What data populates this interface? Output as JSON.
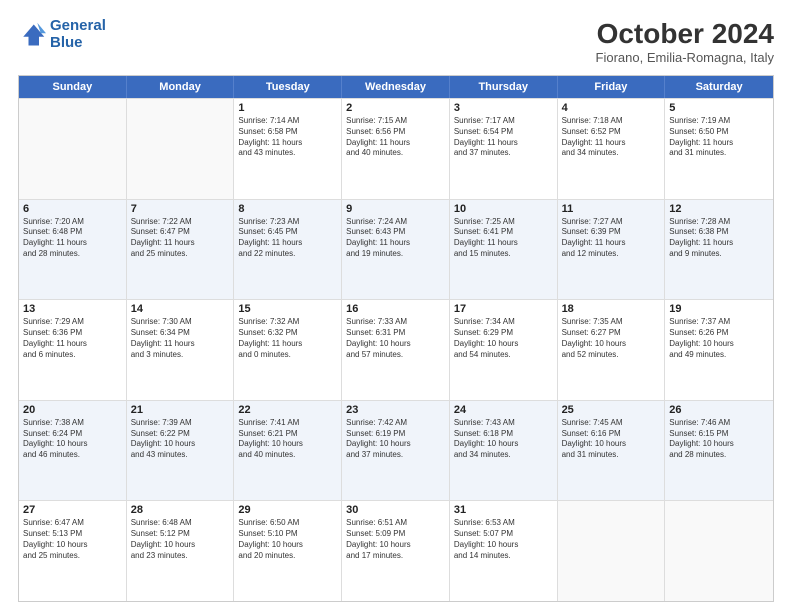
{
  "header": {
    "logo": {
      "line1": "General",
      "line2": "Blue"
    },
    "title": "October 2024",
    "subtitle": "Fiorano, Emilia-Romagna, Italy"
  },
  "weekdays": [
    "Sunday",
    "Monday",
    "Tuesday",
    "Wednesday",
    "Thursday",
    "Friday",
    "Saturday"
  ],
  "rows": [
    {
      "alt": false,
      "cells": [
        {
          "day": "",
          "lines": []
        },
        {
          "day": "",
          "lines": []
        },
        {
          "day": "1",
          "lines": [
            "Sunrise: 7:14 AM",
            "Sunset: 6:58 PM",
            "Daylight: 11 hours",
            "and 43 minutes."
          ]
        },
        {
          "day": "2",
          "lines": [
            "Sunrise: 7:15 AM",
            "Sunset: 6:56 PM",
            "Daylight: 11 hours",
            "and 40 minutes."
          ]
        },
        {
          "day": "3",
          "lines": [
            "Sunrise: 7:17 AM",
            "Sunset: 6:54 PM",
            "Daylight: 11 hours",
            "and 37 minutes."
          ]
        },
        {
          "day": "4",
          "lines": [
            "Sunrise: 7:18 AM",
            "Sunset: 6:52 PM",
            "Daylight: 11 hours",
            "and 34 minutes."
          ]
        },
        {
          "day": "5",
          "lines": [
            "Sunrise: 7:19 AM",
            "Sunset: 6:50 PM",
            "Daylight: 11 hours",
            "and 31 minutes."
          ]
        }
      ]
    },
    {
      "alt": true,
      "cells": [
        {
          "day": "6",
          "lines": [
            "Sunrise: 7:20 AM",
            "Sunset: 6:48 PM",
            "Daylight: 11 hours",
            "and 28 minutes."
          ]
        },
        {
          "day": "7",
          "lines": [
            "Sunrise: 7:22 AM",
            "Sunset: 6:47 PM",
            "Daylight: 11 hours",
            "and 25 minutes."
          ]
        },
        {
          "day": "8",
          "lines": [
            "Sunrise: 7:23 AM",
            "Sunset: 6:45 PM",
            "Daylight: 11 hours",
            "and 22 minutes."
          ]
        },
        {
          "day": "9",
          "lines": [
            "Sunrise: 7:24 AM",
            "Sunset: 6:43 PM",
            "Daylight: 11 hours",
            "and 19 minutes."
          ]
        },
        {
          "day": "10",
          "lines": [
            "Sunrise: 7:25 AM",
            "Sunset: 6:41 PM",
            "Daylight: 11 hours",
            "and 15 minutes."
          ]
        },
        {
          "day": "11",
          "lines": [
            "Sunrise: 7:27 AM",
            "Sunset: 6:39 PM",
            "Daylight: 11 hours",
            "and 12 minutes."
          ]
        },
        {
          "day": "12",
          "lines": [
            "Sunrise: 7:28 AM",
            "Sunset: 6:38 PM",
            "Daylight: 11 hours",
            "and 9 minutes."
          ]
        }
      ]
    },
    {
      "alt": false,
      "cells": [
        {
          "day": "13",
          "lines": [
            "Sunrise: 7:29 AM",
            "Sunset: 6:36 PM",
            "Daylight: 11 hours",
            "and 6 minutes."
          ]
        },
        {
          "day": "14",
          "lines": [
            "Sunrise: 7:30 AM",
            "Sunset: 6:34 PM",
            "Daylight: 11 hours",
            "and 3 minutes."
          ]
        },
        {
          "day": "15",
          "lines": [
            "Sunrise: 7:32 AM",
            "Sunset: 6:32 PM",
            "Daylight: 11 hours",
            "and 0 minutes."
          ]
        },
        {
          "day": "16",
          "lines": [
            "Sunrise: 7:33 AM",
            "Sunset: 6:31 PM",
            "Daylight: 10 hours",
            "and 57 minutes."
          ]
        },
        {
          "day": "17",
          "lines": [
            "Sunrise: 7:34 AM",
            "Sunset: 6:29 PM",
            "Daylight: 10 hours",
            "and 54 minutes."
          ]
        },
        {
          "day": "18",
          "lines": [
            "Sunrise: 7:35 AM",
            "Sunset: 6:27 PM",
            "Daylight: 10 hours",
            "and 52 minutes."
          ]
        },
        {
          "day": "19",
          "lines": [
            "Sunrise: 7:37 AM",
            "Sunset: 6:26 PM",
            "Daylight: 10 hours",
            "and 49 minutes."
          ]
        }
      ]
    },
    {
      "alt": true,
      "cells": [
        {
          "day": "20",
          "lines": [
            "Sunrise: 7:38 AM",
            "Sunset: 6:24 PM",
            "Daylight: 10 hours",
            "and 46 minutes."
          ]
        },
        {
          "day": "21",
          "lines": [
            "Sunrise: 7:39 AM",
            "Sunset: 6:22 PM",
            "Daylight: 10 hours",
            "and 43 minutes."
          ]
        },
        {
          "day": "22",
          "lines": [
            "Sunrise: 7:41 AM",
            "Sunset: 6:21 PM",
            "Daylight: 10 hours",
            "and 40 minutes."
          ]
        },
        {
          "day": "23",
          "lines": [
            "Sunrise: 7:42 AM",
            "Sunset: 6:19 PM",
            "Daylight: 10 hours",
            "and 37 minutes."
          ]
        },
        {
          "day": "24",
          "lines": [
            "Sunrise: 7:43 AM",
            "Sunset: 6:18 PM",
            "Daylight: 10 hours",
            "and 34 minutes."
          ]
        },
        {
          "day": "25",
          "lines": [
            "Sunrise: 7:45 AM",
            "Sunset: 6:16 PM",
            "Daylight: 10 hours",
            "and 31 minutes."
          ]
        },
        {
          "day": "26",
          "lines": [
            "Sunrise: 7:46 AM",
            "Sunset: 6:15 PM",
            "Daylight: 10 hours",
            "and 28 minutes."
          ]
        }
      ]
    },
    {
      "alt": false,
      "cells": [
        {
          "day": "27",
          "lines": [
            "Sunrise: 6:47 AM",
            "Sunset: 5:13 PM",
            "Daylight: 10 hours",
            "and 25 minutes."
          ]
        },
        {
          "day": "28",
          "lines": [
            "Sunrise: 6:48 AM",
            "Sunset: 5:12 PM",
            "Daylight: 10 hours",
            "and 23 minutes."
          ]
        },
        {
          "day": "29",
          "lines": [
            "Sunrise: 6:50 AM",
            "Sunset: 5:10 PM",
            "Daylight: 10 hours",
            "and 20 minutes."
          ]
        },
        {
          "day": "30",
          "lines": [
            "Sunrise: 6:51 AM",
            "Sunset: 5:09 PM",
            "Daylight: 10 hours",
            "and 17 minutes."
          ]
        },
        {
          "day": "31",
          "lines": [
            "Sunrise: 6:53 AM",
            "Sunset: 5:07 PM",
            "Daylight: 10 hours",
            "and 14 minutes."
          ]
        },
        {
          "day": "",
          "lines": []
        },
        {
          "day": "",
          "lines": []
        }
      ]
    }
  ]
}
